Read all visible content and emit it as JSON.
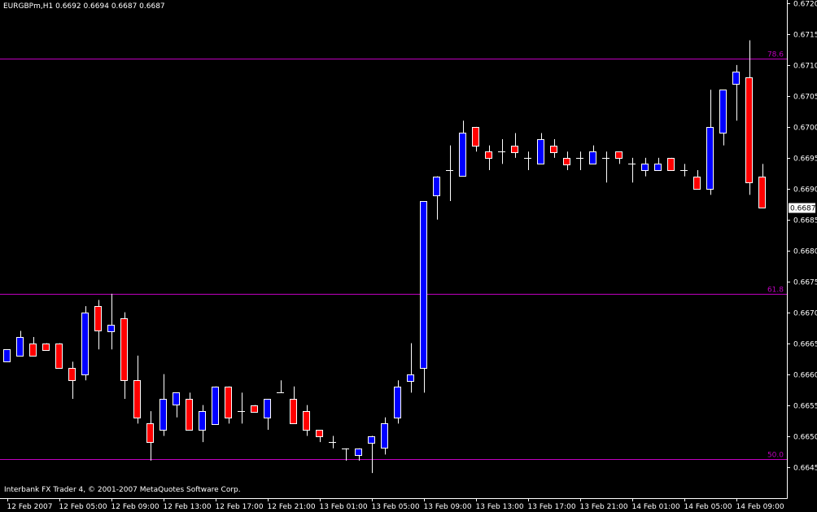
{
  "header": {
    "symbol": "EURGBPm,H1",
    "ohlc": "0.6692 0.6694 0.6687 0.6687"
  },
  "footer": {
    "copyright": "Interbank FX Trader 4, © 2001-2007 MetaQuotes Software Corp."
  },
  "colors": {
    "background": "#000000",
    "bull": "#0000ff",
    "bear": "#ff0000",
    "wick": "#ffffff",
    "fib_line": "#c000c0",
    "current_price_box": "#ffffff"
  },
  "chart_data": {
    "type": "candlestick",
    "title": "EURGBPm,H1",
    "timeframe": "H1",
    "ylim": [
      0.66425,
      0.672
    ],
    "y_ticks": [
      "0.6720",
      "0.6715",
      "0.6710",
      "0.6705",
      "0.6700",
      "0.6695",
      "0.6690",
      "0.6685",
      "0.6680",
      "0.6675",
      "0.6670",
      "0.6665",
      "0.6660",
      "0.6655",
      "0.6650",
      "0.6645"
    ],
    "x_ticks": [
      "12 Feb 2007",
      "12 Feb 05:00",
      "12 Feb 09:00",
      "12 Feb 13:00",
      "12 Feb 17:00",
      "12 Feb 21:00",
      "13 Feb 01:00",
      "13 Feb 05:00",
      "13 Feb 09:00",
      "13 Feb 13:00",
      "13 Feb 17:00",
      "13 Feb 21:00",
      "14 Feb 01:00",
      "14 Feb 05:00",
      "14 Feb 09:00"
    ],
    "current_price": "0.6687",
    "grid": false,
    "levels": [
      {
        "label": "78.6",
        "price": 0.67111
      },
      {
        "label": "61.8",
        "price": 0.6673
      },
      {
        "label": "50.0",
        "price": 0.66462
      }
    ],
    "candles": [
      {
        "o": 0.6662,
        "h": 0.6664,
        "l": 0.6662,
        "c": 0.6664
      },
      {
        "o": 0.6663,
        "h": 0.6667,
        "l": 0.6663,
        "c": 0.6666
      },
      {
        "o": 0.6665,
        "h": 0.6666,
        "l": 0.6663,
        "c": 0.6663
      },
      {
        "o": 0.6665,
        "h": 0.6665,
        "l": 0.6664,
        "c": 0.6664
      },
      {
        "o": 0.6665,
        "h": 0.6665,
        "l": 0.6661,
        "c": 0.6661
      },
      {
        "o": 0.6661,
        "h": 0.6662,
        "l": 0.6656,
        "c": 0.6659
      },
      {
        "o": 0.666,
        "h": 0.6671,
        "l": 0.6659,
        "c": 0.667
      },
      {
        "o": 0.6671,
        "h": 0.6672,
        "l": 0.6664,
        "c": 0.6667
      },
      {
        "o": 0.6667,
        "h": 0.6673,
        "l": 0.6664,
        "c": 0.6668
      },
      {
        "o": 0.6669,
        "h": 0.667,
        "l": 0.6656,
        "c": 0.6659
      },
      {
        "o": 0.6659,
        "h": 0.6663,
        "l": 0.6652,
        "c": 0.6653
      },
      {
        "o": 0.6652,
        "h": 0.6654,
        "l": 0.6646,
        "c": 0.6649
      },
      {
        "o": 0.6651,
        "h": 0.666,
        "l": 0.665,
        "c": 0.6656
      },
      {
        "o": 0.6655,
        "h": 0.6657,
        "l": 0.6653,
        "c": 0.6657
      },
      {
        "o": 0.6656,
        "h": 0.6657,
        "l": 0.6651,
        "c": 0.6651
      },
      {
        "o": 0.6651,
        "h": 0.6655,
        "l": 0.6649,
        "c": 0.6654
      },
      {
        "o": 0.6652,
        "h": 0.6658,
        "l": 0.6652,
        "c": 0.6658
      },
      {
        "o": 0.6658,
        "h": 0.6658,
        "l": 0.6652,
        "c": 0.6653
      },
      {
        "o": 0.6654,
        "h": 0.6657,
        "l": 0.6652,
        "c": 0.6654
      },
      {
        "o": 0.6655,
        "h": 0.6655,
        "l": 0.6654,
        "c": 0.6654
      },
      {
        "o": 0.6653,
        "h": 0.6656,
        "l": 0.6651,
        "c": 0.6656
      },
      {
        "o": 0.6657,
        "h": 0.6659,
        "l": 0.6657,
        "c": 0.6657
      },
      {
        "o": 0.6656,
        "h": 0.6658,
        "l": 0.6652,
        "c": 0.6652
      },
      {
        "o": 0.6654,
        "h": 0.6655,
        "l": 0.665,
        "c": 0.6651
      },
      {
        "o": 0.6651,
        "h": 0.6651,
        "l": 0.6649,
        "c": 0.665
      },
      {
        "o": 0.6649,
        "h": 0.665,
        "l": 0.6648,
        "c": 0.6649
      },
      {
        "o": 0.6648,
        "h": 0.6648,
        "l": 0.6646,
        "c": 0.6648
      },
      {
        "o": 0.6647,
        "h": 0.6648,
        "l": 0.6646,
        "c": 0.6648
      },
      {
        "o": 0.6649,
        "h": 0.665,
        "l": 0.6644,
        "c": 0.665
      },
      {
        "o": 0.6648,
        "h": 0.6653,
        "l": 0.6647,
        "c": 0.6652
      },
      {
        "o": 0.6653,
        "h": 0.6659,
        "l": 0.6652,
        "c": 0.6658
      },
      {
        "o": 0.6659,
        "h": 0.6665,
        "l": 0.6657,
        "c": 0.666
      },
      {
        "o": 0.6661,
        "h": 0.6688,
        "l": 0.6657,
        "c": 0.6688
      },
      {
        "o": 0.6689,
        "h": 0.6692,
        "l": 0.6685,
        "c": 0.6692
      },
      {
        "o": 0.6693,
        "h": 0.6697,
        "l": 0.6688,
        "c": 0.6693
      },
      {
        "o": 0.6692,
        "h": 0.6701,
        "l": 0.6692,
        "c": 0.6699
      },
      {
        "o": 0.67,
        "h": 0.67,
        "l": 0.6696,
        "c": 0.6697
      },
      {
        "o": 0.6696,
        "h": 0.6697,
        "l": 0.6693,
        "c": 0.6695
      },
      {
        "o": 0.6696,
        "h": 0.6698,
        "l": 0.6694,
        "c": 0.6696
      },
      {
        "o": 0.6697,
        "h": 0.6699,
        "l": 0.6695,
        "c": 0.6696
      },
      {
        "o": 0.6695,
        "h": 0.6696,
        "l": 0.6693,
        "c": 0.6695
      },
      {
        "o": 0.6694,
        "h": 0.6699,
        "l": 0.6694,
        "c": 0.6698
      },
      {
        "o": 0.6697,
        "h": 0.6698,
        "l": 0.6695,
        "c": 0.6696
      },
      {
        "o": 0.6695,
        "h": 0.6696,
        "l": 0.6693,
        "c": 0.6694
      },
      {
        "o": 0.6695,
        "h": 0.6696,
        "l": 0.6693,
        "c": 0.6695
      },
      {
        "o": 0.6694,
        "h": 0.6697,
        "l": 0.6694,
        "c": 0.6696
      },
      {
        "o": 0.6695,
        "h": 0.6696,
        "l": 0.6691,
        "c": 0.6695
      },
      {
        "o": 0.6696,
        "h": 0.6696,
        "l": 0.6694,
        "c": 0.6695
      },
      {
        "o": 0.6694,
        "h": 0.6695,
        "l": 0.6691,
        "c": 0.6694
      },
      {
        "o": 0.6693,
        "h": 0.6695,
        "l": 0.6692,
        "c": 0.6694
      },
      {
        "o": 0.6693,
        "h": 0.6695,
        "l": 0.6693,
        "c": 0.6694
      },
      {
        "o": 0.6695,
        "h": 0.6695,
        "l": 0.6693,
        "c": 0.6693
      },
      {
        "o": 0.6693,
        "h": 0.6694,
        "l": 0.6692,
        "c": 0.6693
      },
      {
        "o": 0.6692,
        "h": 0.6693,
        "l": 0.669,
        "c": 0.669
      },
      {
        "o": 0.669,
        "h": 0.6706,
        "l": 0.6689,
        "c": 0.67
      },
      {
        "o": 0.6699,
        "h": 0.6706,
        "l": 0.6697,
        "c": 0.6706
      },
      {
        "o": 0.6707,
        "h": 0.671,
        "l": 0.6701,
        "c": 0.6709
      },
      {
        "o": 0.6708,
        "h": 0.6714,
        "l": 0.6689,
        "c": 0.6691
      },
      {
        "o": 0.6692,
        "h": 0.6694,
        "l": 0.6687,
        "c": 0.6687
      }
    ]
  }
}
